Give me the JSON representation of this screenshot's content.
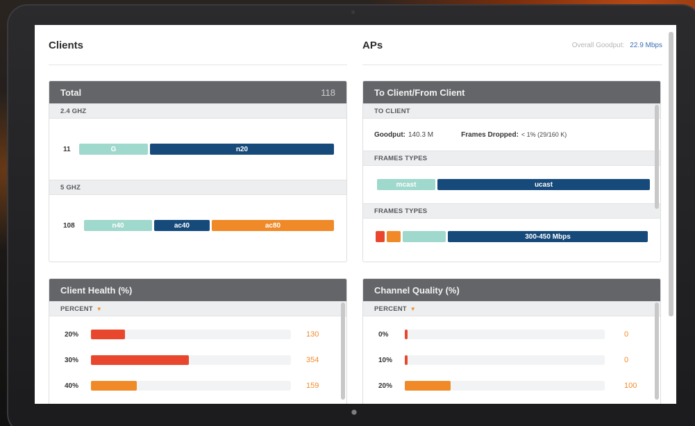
{
  "clients": {
    "title": "Clients",
    "total_card": {
      "title": "Total",
      "count": "118",
      "bands": [
        {
          "label": "2.4 GHZ",
          "count": "11",
          "segments": [
            {
              "label": "G",
              "color": "#9fd8cc"
            },
            {
              "label": "n20",
              "color": "#164a7a"
            }
          ]
        },
        {
          "label": "5 GHZ",
          "count": "108",
          "segments": [
            {
              "label": "n40",
              "color": "#9fd8cc"
            },
            {
              "label": "ac40",
              "color": "#164a7a"
            },
            {
              "label": "ac80",
              "color": "#f08a28"
            }
          ]
        }
      ]
    },
    "health_card": {
      "title": "Client Health (%)",
      "sub_label": "PERCENT",
      "rows": [
        {
          "label": "20%",
          "value": "130",
          "fraction": 0.17,
          "color": "#e8472e"
        },
        {
          "label": "30%",
          "value": "354",
          "fraction": 0.49,
          "color": "#e8472e"
        },
        {
          "label": "40%",
          "value": "159",
          "fraction": 0.23,
          "color": "#f08a28"
        }
      ]
    }
  },
  "aps": {
    "title": "APs",
    "overall_goodput_label": "Overall Goodput:",
    "overall_goodput_value": "22.9 Mbps",
    "traffic_card": {
      "title": "To Client/From Client",
      "to_client_label": "TO CLIENT",
      "goodput_label": "Goodput:",
      "goodput_value": "140.3 M",
      "frames_dropped_label": "Frames Dropped:",
      "frames_dropped_value": "< 1% (29/160 K)",
      "frame_types_label_1": "FRAMES TYPES",
      "frame_types_segments": [
        {
          "label": "mcast",
          "color": "#9fd8cc"
        },
        {
          "label": "ucast",
          "color": "#164a7a"
        }
      ],
      "frame_types_label_2": "FRAMES TYPES",
      "rate_segments": [
        {
          "label": "",
          "color": "#e8472e"
        },
        {
          "label": "",
          "color": "#f08a28"
        },
        {
          "label": "",
          "color": "#9fd8cc"
        },
        {
          "label": "300-450 Mbps",
          "color": "#164a7a"
        }
      ]
    },
    "quality_card": {
      "title": "Channel Quality (%)",
      "sub_label": "PERCENT",
      "rows": [
        {
          "label": "0%",
          "value": "0",
          "fraction": 0.01,
          "color": "#e8472e"
        },
        {
          "label": "10%",
          "value": "0",
          "fraction": 0.01,
          "color": "#e8472e"
        },
        {
          "label": "20%",
          "value": "100",
          "fraction": 0.23,
          "color": "#f08a28"
        }
      ]
    }
  },
  "caret_icon": "caret-down-icon"
}
